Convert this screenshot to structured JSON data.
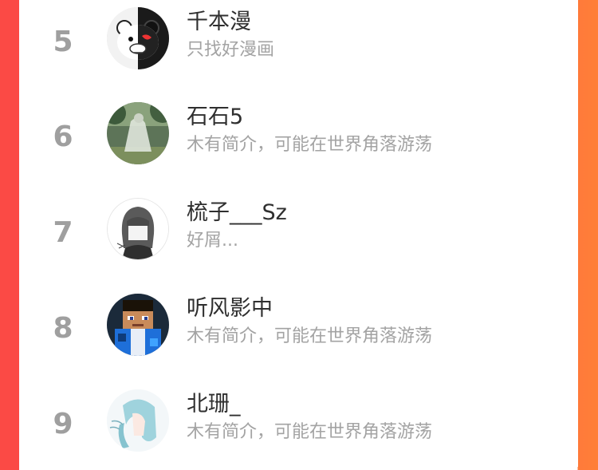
{
  "ranking": [
    {
      "rank": "5",
      "name": "千本漫",
      "bio": "只找好漫画",
      "avatar_icon": "monokuma-avatar-icon"
    },
    {
      "rank": "6",
      "name": "石石5",
      "bio": "木有简介，可能在世界角落游荡",
      "avatar_icon": "forest-girl-avatar-icon"
    },
    {
      "rank": "7",
      "name": "梳子___Sz",
      "bio": "好屑...",
      "avatar_icon": "sketch-girl-avatar-icon"
    },
    {
      "rank": "8",
      "name": "听风影中",
      "bio": "木有简介，可能在世界角落游荡",
      "avatar_icon": "pixel-character-avatar-icon"
    },
    {
      "rank": "9",
      "name": "北珊_",
      "bio": "木有简介，可能在世界角落游荡",
      "avatar_icon": "anime-girl-avatar-icon"
    }
  ],
  "colors": {
    "left_edge": "#fb4a45",
    "right_edge": "#ff7a3a",
    "rank": "#9f9f9f",
    "name": "#2f2f2f",
    "bio": "#a3a3a3"
  }
}
